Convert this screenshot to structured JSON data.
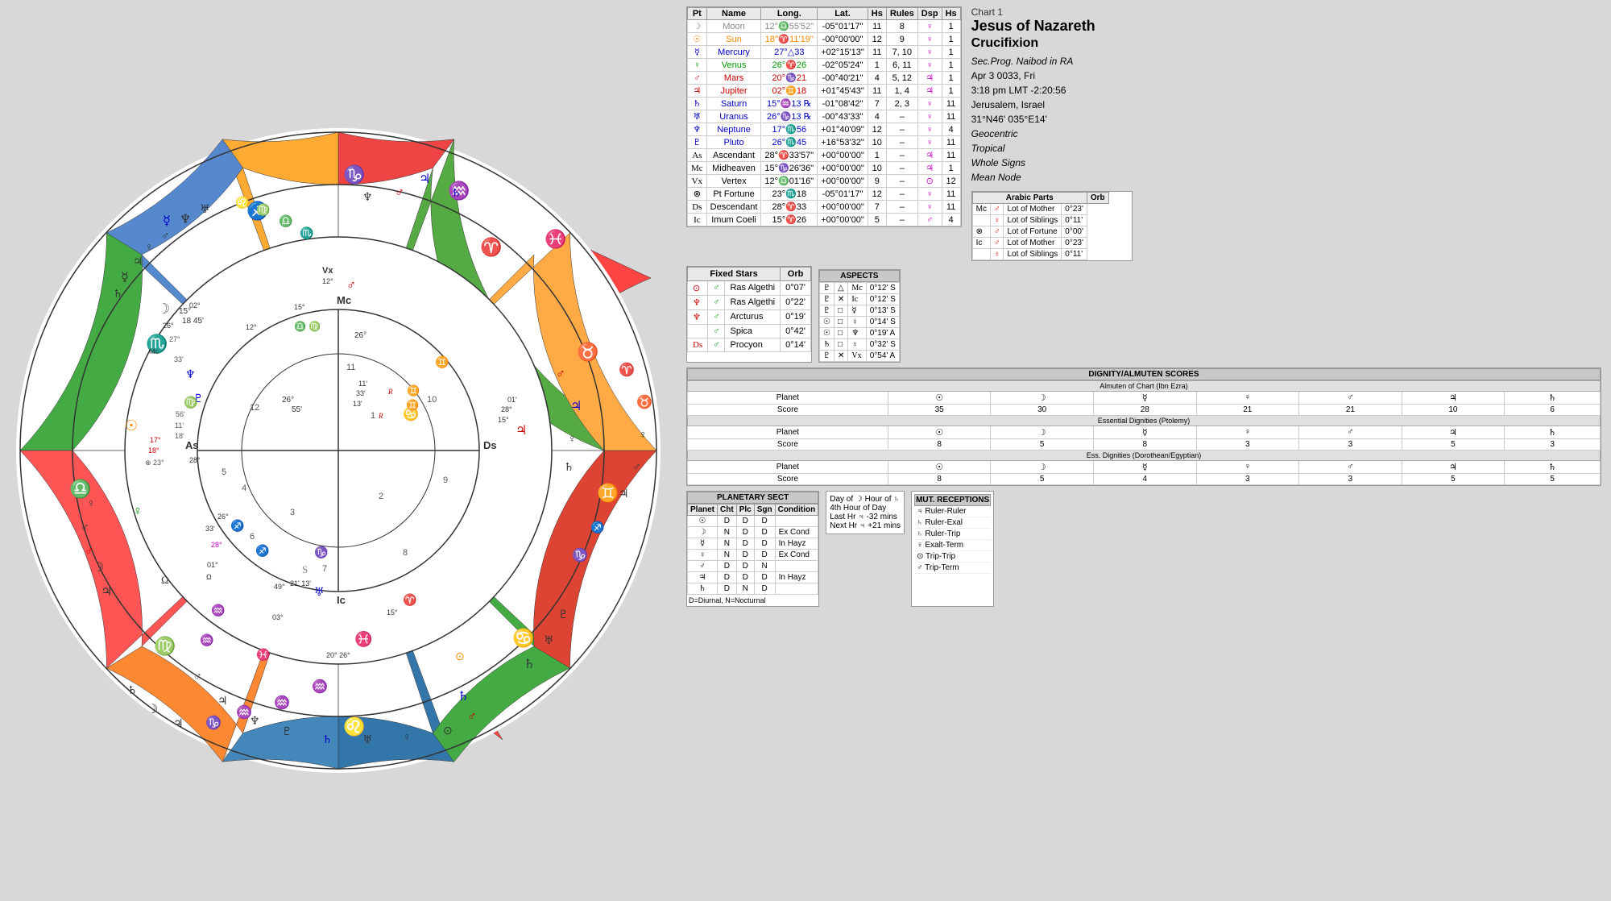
{
  "chart": {
    "title": "Chart 1",
    "name": "Jesus of Nazareth",
    "subtitle": "Crucifixion",
    "progType": "Sec.Prog. Naibod in RA",
    "date": "Apr 3 0033, Fri",
    "time": "3:18 pm  LMT -2:20:56",
    "location": "Jerusalem, Israel",
    "coords": "31°N46'  035°E14'",
    "system": "Geocentric",
    "zodiac": "Tropical",
    "houseSystem": "Whole Signs",
    "nodeType": "Mean Node"
  },
  "planets": [
    {
      "symbol": "☽",
      "name": "Moon",
      "long": "12°♎55'52\"",
      "lat": "-05°01'17\"",
      "hs": "11",
      "rules": "8",
      "dsp": "♀",
      "dspHs": "1",
      "color": "#888888"
    },
    {
      "symbol": "☉",
      "name": "Sun",
      "long": "18°♈11'19\"",
      "lat": "-00°00'00\"",
      "hs": "12",
      "rules": "9",
      "dsp": "♀",
      "dspHs": "1",
      "color": "#ff8800"
    },
    {
      "symbol": "☿",
      "name": "Mercury",
      "long": "27°△33",
      "lat": "+02°15'13\"",
      "hs": "11",
      "rules": "7, 10",
      "dsp": "♀",
      "dspHs": "1",
      "color": "#0000cc"
    },
    {
      "symbol": "♀",
      "name": "Venus",
      "long": "26°♈26",
      "lat": "-02°05'24\"",
      "hs": "1",
      "rules": "6, 11",
      "dsp": "♀",
      "dspHs": "1",
      "color": "#00aa00"
    },
    {
      "symbol": "♂",
      "name": "Mars",
      "long": "20°♑21",
      "lat": "-00°40'21\"",
      "hs": "4",
      "rules": "5, 12",
      "dsp": "♃",
      "dspHs": "1",
      "color": "#cc0000"
    },
    {
      "symbol": "♃",
      "name": "Jupiter",
      "long": "02°♊18",
      "lat": "+01°45'43\"",
      "hs": "11",
      "rules": "1, 4",
      "dsp": "♃",
      "dspHs": "1",
      "color": "#cc0000"
    },
    {
      "symbol": "♄",
      "name": "Saturn",
      "long": "15°♒13 ℞",
      "lat": "-01°08'42\"",
      "hs": "7",
      "rules": "2, 3",
      "dsp": "♀",
      "dspHs": "11",
      "color": "#0000cc"
    },
    {
      "symbol": "♅",
      "name": "Uranus",
      "long": "26°♑13 ℞",
      "lat": "-00°43'33\"",
      "hs": "4",
      "rules": "–",
      "dsp": "♀",
      "dspHs": "11",
      "color": "#0000cc"
    },
    {
      "symbol": "♆",
      "name": "Neptune",
      "long": "17°♏56",
      "lat": "+01°40'09\"",
      "hs": "12",
      "rules": "–",
      "dsp": "♀",
      "dspHs": "4",
      "color": "#0000cc"
    },
    {
      "symbol": "♇",
      "name": "Pluto",
      "long": "26°♏45",
      "lat": "+16°53'32\"",
      "hs": "10",
      "rules": "–",
      "dsp": "♀",
      "dspHs": "11",
      "color": "#0000cc"
    },
    {
      "symbol": "As",
      "name": "Ascendant",
      "long": "28°♈33'57\"",
      "lat": "+00°00'00\"",
      "hs": "1",
      "rules": "–",
      "dsp": "♃",
      "dspHs": "11",
      "color": "#000000"
    },
    {
      "symbol": "Mc",
      "name": "Midheaven",
      "long": "15°♑26'36\"",
      "lat": "+00°00'00\"",
      "hs": "10",
      "rules": "–",
      "dsp": "♃",
      "dspHs": "1",
      "color": "#000000"
    },
    {
      "symbol": "Vx",
      "name": "Vertex",
      "long": "12°♎01'16\"",
      "lat": "+00°00'00\"",
      "hs": "9",
      "rules": "–",
      "dsp": "⊙",
      "dspHs": "12",
      "color": "#000000"
    },
    {
      "symbol": "⊗",
      "name": "Pt Fortune",
      "long": "23°♏18",
      "lat": "-05°01'17\"",
      "hs": "12",
      "rules": "–",
      "dsp": "♀",
      "dspHs": "11",
      "color": "#000000"
    },
    {
      "symbol": "Ds",
      "name": "Descendant",
      "long": "28°♈33",
      "lat": "+00°00'00\"",
      "hs": "7",
      "rules": "–",
      "dsp": "♀",
      "dspHs": "11",
      "color": "#000000"
    },
    {
      "symbol": "Ic",
      "name": "Imum Coeli",
      "long": "15°♈26",
      "lat": "+00°00'00\"",
      "hs": "5",
      "rules": "–",
      "dsp": "♂",
      "dspHs": "4",
      "color": "#000000"
    }
  ],
  "arabicParts": [
    {
      "point": "Mc",
      "planet": "♂",
      "name": "Lot of Mother",
      "orb": "0°23'"
    },
    {
      "point": "",
      "planet": "♀",
      "name": "Lot of Siblings",
      "orb": "0°11'"
    },
    {
      "point": "⊗",
      "planet": "♂",
      "name": "Lot of Fortune",
      "orb": "0°00'"
    },
    {
      "point": "Ic",
      "planet": "♂",
      "name": "Lot of Mother",
      "orb": "0°23'"
    },
    {
      "point": "",
      "planet": "♀",
      "name": "Lot of Siblings",
      "orb": "0°11'"
    }
  ],
  "aspects": [
    {
      "p1": "♇",
      "asp": "△",
      "p2": "Mc",
      "orb": "0°12' S"
    },
    {
      "p1": "♇",
      "asp": "✕",
      "p2": "Ic",
      "orb": "0°12' S"
    },
    {
      "p1": "♇",
      "asp": "□",
      "p2": "☿",
      "orb": "0°13' S"
    },
    {
      "p1": "☉",
      "asp": "□",
      "p2": "♀",
      "orb": "0°14' S"
    },
    {
      "p1": "☉",
      "asp": "□",
      "p2": "♆",
      "orb": "0°19' A"
    },
    {
      "p1": "♄",
      "asp": "□",
      "p2": "♀",
      "orb": "0°32' S"
    },
    {
      "p1": "♇",
      "asp": "✕",
      "p2": "Vx",
      "orb": "0°54' A"
    }
  ],
  "fixedStars": [
    {
      "planet": "⊙",
      "asp": "♂",
      "star": "Ras Algethi",
      "orb": "0°07'"
    },
    {
      "planet": "♆",
      "asp": "♂",
      "star": "Ras Algethi",
      "orb": "0°22'"
    },
    {
      "planet": "♆",
      "asp": "♂",
      "star": "Arcturus",
      "orb": "0°19'"
    },
    {
      "planet": "",
      "asp": "♂",
      "star": "Spica",
      "orb": "0°42'"
    },
    {
      "planet": "Ds",
      "asp": "♂",
      "star": "Procyon",
      "orb": "0°14'"
    }
  ],
  "dignityScores": {
    "almuten": {
      "planets": [
        "☉",
        "☽",
        "☿",
        "♀",
        "♂",
        "♃",
        "♄"
      ],
      "scores": [
        "35",
        "30",
        "28",
        "21",
        "21",
        "10",
        "6"
      ]
    },
    "essential": {
      "planets": [
        "☉",
        "☽",
        "☿",
        "♀",
        "♂",
        "♃",
        "♄"
      ],
      "scores": [
        "8",
        "5",
        "8",
        "3",
        "3",
        "5",
        "3"
      ]
    },
    "dorothean": {
      "planets": [
        "☉",
        "☽",
        "☿",
        "♀",
        "♂",
        "♃",
        "♄"
      ],
      "scores": [
        "8",
        "5",
        "4",
        "3",
        "3",
        "5",
        "5"
      ]
    }
  },
  "planetarySect": [
    {
      "planet": "☉",
      "cht": "D",
      "plc": "D",
      "sgn": "D",
      "condition": ""
    },
    {
      "planet": "☽",
      "cht": "N",
      "plc": "D",
      "sgn": "D",
      "condition": "Ex Cond"
    },
    {
      "planet": "☿",
      "cht": "N",
      "plc": "D",
      "sgn": "D",
      "condition": "In Hayz"
    },
    {
      "planet": "♀",
      "cht": "N",
      "plc": "D",
      "sgn": "D",
      "condition": "Ex Cond"
    },
    {
      "planet": "♂",
      "cht": "D",
      "plc": "D",
      "sgn": "N",
      "condition": ""
    },
    {
      "planet": "♃",
      "cht": "D",
      "plc": "D",
      "sgn": "D",
      "condition": "In Hayz"
    },
    {
      "planet": "♄",
      "cht": "D",
      "plc": "N",
      "sgn": "D",
      "condition": ""
    }
  ],
  "mutReceptions": [
    "♃ Ruler-Ruler",
    "♄ Ruler-Exal",
    "♄ Ruler-Trip",
    "♀ Exalt-Term",
    "⊙ Trip-Trip",
    "♂ Trip-Term"
  ],
  "sectNote": {
    "line1": "Day of ☽ Hour of ♄",
    "line2": "4th Hour of Day",
    "line3": "Last Hr ♃ -32 mins",
    "line4": "Next Hr ♃ +21 mins",
    "footnote": "D=Diurnal, N=Nocturnal"
  }
}
